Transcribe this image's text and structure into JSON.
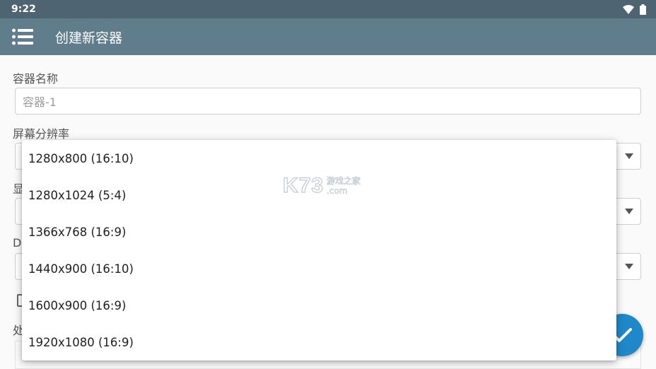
{
  "status_bar": {
    "time": "9:22"
  },
  "app_bar": {
    "title": "创建新容器"
  },
  "form": {
    "name_label": "容器名称",
    "name_placeholder": "容器-1",
    "resolution_label": "屏幕分辨率",
    "label_3_partial": "显",
    "label_4_partial": "D",
    "label_5_partial": "处"
  },
  "resolution_options": [
    "1280x800 (16:10)",
    "1280x1024 (5:4)",
    "1366x768 (16:9)",
    "1440x900 (16:10)",
    "1600x900 (16:9)",
    "1920x1080 (16:9)"
  ],
  "watermark": {
    "logo": "K73",
    "cn": "游戏之家",
    "domain": ".com"
  },
  "colors": {
    "status_bar": "#4e6472",
    "app_bar": "#607d8b",
    "fab": "#1e88c8"
  }
}
